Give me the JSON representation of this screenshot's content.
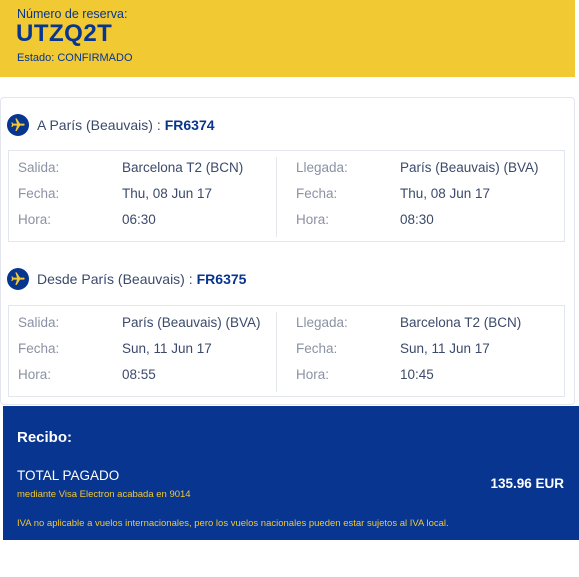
{
  "reservation": {
    "label": "Número de reserva:",
    "code": "UTZQ2T",
    "status": "Estado: CONFIRMADO"
  },
  "flights": [
    {
      "title": "A París (Beauvais) :",
      "flight_number": "FR6374",
      "departure": {
        "salida_label": "Salida:",
        "salida": "Barcelona T2 (BCN)",
        "fecha_label": "Fecha:",
        "fecha": "Thu, 08 Jun 17",
        "hora_label": "Hora:",
        "hora": "06:30"
      },
      "arrival": {
        "llegada_label": "Llegada:",
        "llegada": "París (Beauvais) (BVA)",
        "fecha_label": "Fecha:",
        "fecha": "Thu, 08 Jun 17",
        "hora_label": "Hora:",
        "hora": "08:30"
      }
    },
    {
      "title": "Desde París (Beauvais) :",
      "flight_number": "FR6375",
      "departure": {
        "salida_label": "Salida:",
        "salida": "París (Beauvais) (BVA)",
        "fecha_label": "Fecha:",
        "fecha": "Sun, 11 Jun 17",
        "hora_label": "Hora:",
        "hora": "08:55"
      },
      "arrival": {
        "llegada_label": "Llegada:",
        "llegada": "Barcelona T2 (BCN)",
        "fecha_label": "Fecha:",
        "fecha": "Sun, 11 Jun 17",
        "hora_label": "Hora:",
        "hora": "10:45"
      }
    }
  ],
  "receipt": {
    "title": "Recibo:",
    "total_label": "TOTAL PAGADO",
    "payment_method": "mediante Visa Electron acabada en 9014",
    "amount": "135.96 EUR",
    "vat_note": "IVA no aplicable a vuelos internacionales, pero los vuelos nacionales pueden estar sujetos al IVA local."
  },
  "colors": {
    "brand_blue": "#073590",
    "brand_yellow": "#f1c933"
  },
  "icons": {
    "segment": "plane-icon"
  }
}
